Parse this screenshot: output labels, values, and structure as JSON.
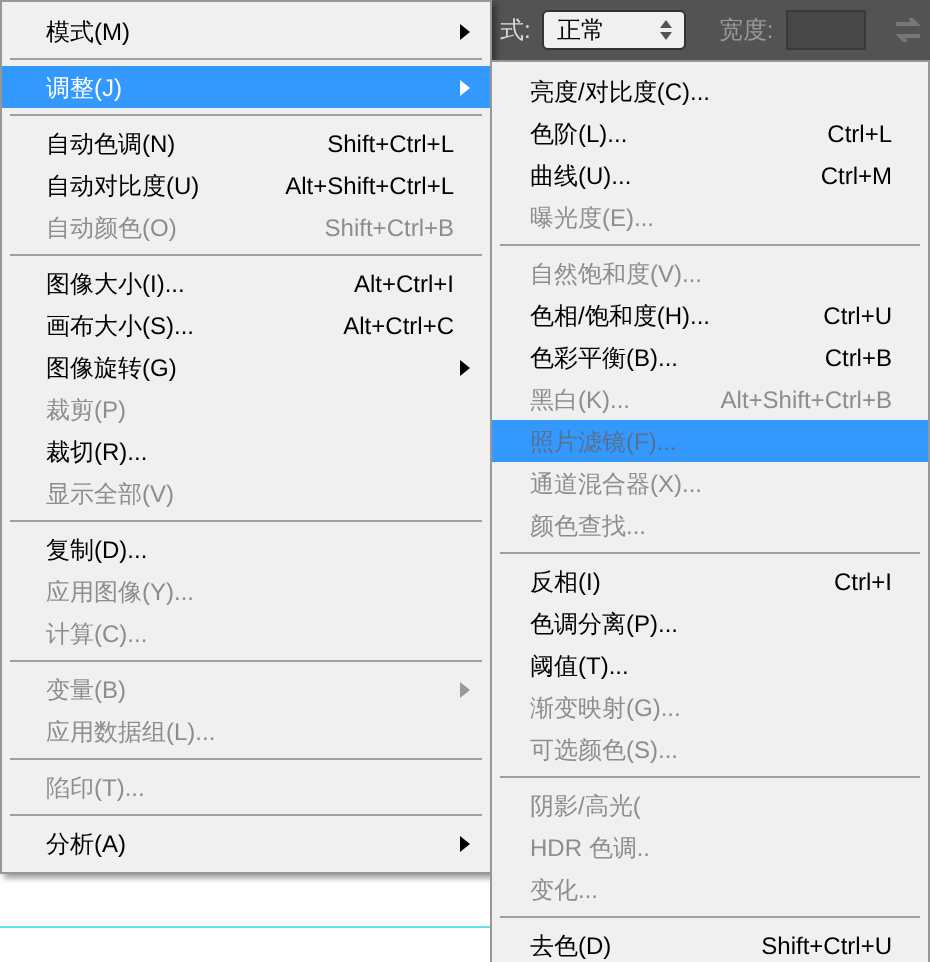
{
  "toolbar": {
    "mode_label": "式:",
    "mode_value": "正常",
    "width_label": "宽度:"
  },
  "menu": {
    "groups": [
      [
        {
          "label": "模式(M)",
          "disabled": false,
          "selected": false,
          "submenu": true
        }
      ],
      [
        {
          "label": "调整(J)",
          "disabled": false,
          "selected": true,
          "submenu": true
        }
      ],
      [
        {
          "label": "自动色调(N)",
          "shortcut": "Shift+Ctrl+L",
          "disabled": false,
          "selected": false,
          "submenu": false
        },
        {
          "label": "自动对比度(U)",
          "shortcut": "Alt+Shift+Ctrl+L",
          "disabled": false,
          "selected": false,
          "submenu": false
        },
        {
          "label": "自动颜色(O)",
          "shortcut": "Shift+Ctrl+B",
          "disabled": true,
          "selected": false,
          "submenu": false
        }
      ],
      [
        {
          "label": "图像大小(I)...",
          "shortcut": "Alt+Ctrl+I",
          "disabled": false,
          "selected": false,
          "submenu": false
        },
        {
          "label": "画布大小(S)...",
          "shortcut": "Alt+Ctrl+C",
          "disabled": false,
          "selected": false,
          "submenu": false
        },
        {
          "label": "图像旋转(G)",
          "disabled": false,
          "selected": false,
          "submenu": true
        },
        {
          "label": "裁剪(P)",
          "disabled": true,
          "selected": false,
          "submenu": false
        },
        {
          "label": "裁切(R)...",
          "disabled": false,
          "selected": false,
          "submenu": false
        },
        {
          "label": "显示全部(V)",
          "disabled": true,
          "selected": false,
          "submenu": false
        }
      ],
      [
        {
          "label": "复制(D)...",
          "disabled": false,
          "selected": false,
          "submenu": false
        },
        {
          "label": "应用图像(Y)...",
          "disabled": true,
          "selected": false,
          "submenu": false
        },
        {
          "label": "计算(C)...",
          "disabled": true,
          "selected": false,
          "submenu": false
        }
      ],
      [
        {
          "label": "变量(B)",
          "disabled": true,
          "selected": false,
          "submenu": true
        },
        {
          "label": "应用数据组(L)...",
          "disabled": true,
          "selected": false,
          "submenu": false
        }
      ],
      [
        {
          "label": "陷印(T)...",
          "disabled": true,
          "selected": false,
          "submenu": false
        }
      ],
      [
        {
          "label": "分析(A)",
          "disabled": false,
          "selected": false,
          "submenu": true
        }
      ]
    ]
  },
  "submenu": {
    "groups": [
      [
        {
          "label": "亮度/对比度(C)...",
          "disabled": false,
          "selected": false
        },
        {
          "label": "色阶(L)...",
          "shortcut": "Ctrl+L",
          "disabled": false,
          "selected": false
        },
        {
          "label": "曲线(U)...",
          "shortcut": "Ctrl+M",
          "disabled": false,
          "selected": false
        },
        {
          "label": "曝光度(E)...",
          "disabled": true,
          "selected": false
        }
      ],
      [
        {
          "label": "自然饱和度(V)...",
          "disabled": true,
          "selected": false
        },
        {
          "label": "色相/饱和度(H)...",
          "shortcut": "Ctrl+U",
          "disabled": false,
          "selected": false
        },
        {
          "label": "色彩平衡(B)...",
          "shortcut": "Ctrl+B",
          "disabled": false,
          "selected": false
        },
        {
          "label": "黑白(K)...",
          "shortcut": "Alt+Shift+Ctrl+B",
          "disabled": true,
          "selected": false
        },
        {
          "label": "照片滤镜(F)...",
          "disabled": true,
          "selected": true
        },
        {
          "label": "通道混合器(X)...",
          "disabled": true,
          "selected": false
        },
        {
          "label": "颜色查找...",
          "disabled": true,
          "selected": false
        }
      ],
      [
        {
          "label": "反相(I)",
          "shortcut": "Ctrl+I",
          "disabled": false,
          "selected": false
        },
        {
          "label": "色调分离(P)...",
          "disabled": false,
          "selected": false
        },
        {
          "label": "阈值(T)...",
          "disabled": false,
          "selected": false
        },
        {
          "label": "渐变映射(G)...",
          "disabled": true,
          "selected": false
        },
        {
          "label": "可选颜色(S)...",
          "disabled": true,
          "selected": false
        }
      ],
      [
        {
          "label": "阴影/高光(",
          "disabled": true,
          "selected": false
        },
        {
          "label": "HDR 色调..",
          "disabled": true,
          "selected": false
        },
        {
          "label": "变化...",
          "disabled": true,
          "selected": false
        }
      ],
      [
        {
          "label": "去色(D)",
          "shortcut": "Shift+Ctrl+U",
          "disabled": false,
          "selected": false
        }
      ]
    ]
  }
}
